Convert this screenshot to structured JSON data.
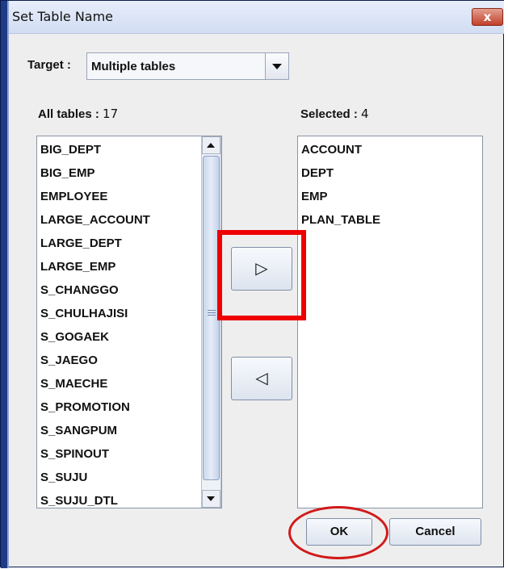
{
  "window": {
    "title": "Set Table Name",
    "close_label": "x"
  },
  "target": {
    "label": "Target :",
    "value": "Multiple tables"
  },
  "all_tables": {
    "label": "All tables :",
    "count": "17",
    "items": [
      "BIG_DEPT",
      "BIG_EMP",
      "EMPLOYEE",
      "LARGE_ACCOUNT",
      "LARGE_DEPT",
      "LARGE_EMP",
      "S_CHANGGO",
      "S_CHULHAJISI",
      "S_GOGAEK",
      "S_JAEGO",
      "S_MAECHE",
      "S_PROMOTION",
      "S_SANGPUM",
      "S_SPINOUT",
      "S_SUJU",
      "S_SUJU_DTL"
    ]
  },
  "selected": {
    "label": "Selected :",
    "count": "4",
    "items": [
      "ACCOUNT",
      "DEPT",
      "EMP",
      "PLAN_TABLE"
    ]
  },
  "buttons": {
    "move_right": "▷",
    "move_left": "◁",
    "ok": "OK",
    "cancel": "Cancel"
  },
  "colors": {
    "highlight": "#ee0000",
    "title_bar": "#d2ddf3"
  }
}
